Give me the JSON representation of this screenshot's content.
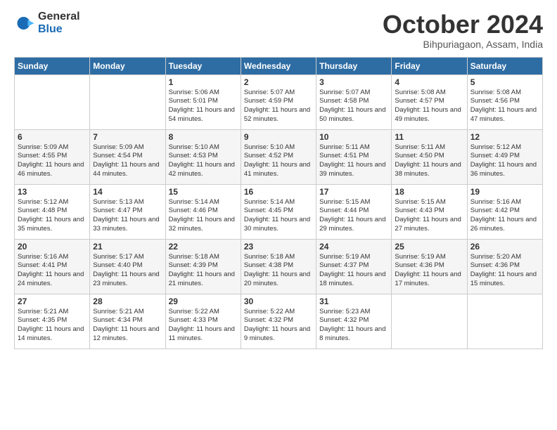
{
  "logo": {
    "general": "General",
    "blue": "Blue"
  },
  "title": "October 2024",
  "location": "Bihpuriagaon, Assam, India",
  "days_header": [
    "Sunday",
    "Monday",
    "Tuesday",
    "Wednesday",
    "Thursday",
    "Friday",
    "Saturday"
  ],
  "weeks": [
    [
      {
        "day": "",
        "info": ""
      },
      {
        "day": "",
        "info": ""
      },
      {
        "day": "1",
        "info": "Sunrise: 5:06 AM\nSunset: 5:01 PM\nDaylight: 11 hours\nand 54 minutes."
      },
      {
        "day": "2",
        "info": "Sunrise: 5:07 AM\nSunset: 4:59 PM\nDaylight: 11 hours\nand 52 minutes."
      },
      {
        "day": "3",
        "info": "Sunrise: 5:07 AM\nSunset: 4:58 PM\nDaylight: 11 hours\nand 50 minutes."
      },
      {
        "day": "4",
        "info": "Sunrise: 5:08 AM\nSunset: 4:57 PM\nDaylight: 11 hours\nand 49 minutes."
      },
      {
        "day": "5",
        "info": "Sunrise: 5:08 AM\nSunset: 4:56 PM\nDaylight: 11 hours\nand 47 minutes."
      }
    ],
    [
      {
        "day": "6",
        "info": "Sunrise: 5:09 AM\nSunset: 4:55 PM\nDaylight: 11 hours\nand 46 minutes."
      },
      {
        "day": "7",
        "info": "Sunrise: 5:09 AM\nSunset: 4:54 PM\nDaylight: 11 hours\nand 44 minutes."
      },
      {
        "day": "8",
        "info": "Sunrise: 5:10 AM\nSunset: 4:53 PM\nDaylight: 11 hours\nand 42 minutes."
      },
      {
        "day": "9",
        "info": "Sunrise: 5:10 AM\nSunset: 4:52 PM\nDaylight: 11 hours\nand 41 minutes."
      },
      {
        "day": "10",
        "info": "Sunrise: 5:11 AM\nSunset: 4:51 PM\nDaylight: 11 hours\nand 39 minutes."
      },
      {
        "day": "11",
        "info": "Sunrise: 5:11 AM\nSunset: 4:50 PM\nDaylight: 11 hours\nand 38 minutes."
      },
      {
        "day": "12",
        "info": "Sunrise: 5:12 AM\nSunset: 4:49 PM\nDaylight: 11 hours\nand 36 minutes."
      }
    ],
    [
      {
        "day": "13",
        "info": "Sunrise: 5:12 AM\nSunset: 4:48 PM\nDaylight: 11 hours\nand 35 minutes."
      },
      {
        "day": "14",
        "info": "Sunrise: 5:13 AM\nSunset: 4:47 PM\nDaylight: 11 hours\nand 33 minutes."
      },
      {
        "day": "15",
        "info": "Sunrise: 5:14 AM\nSunset: 4:46 PM\nDaylight: 11 hours\nand 32 minutes."
      },
      {
        "day": "16",
        "info": "Sunrise: 5:14 AM\nSunset: 4:45 PM\nDaylight: 11 hours\nand 30 minutes."
      },
      {
        "day": "17",
        "info": "Sunrise: 5:15 AM\nSunset: 4:44 PM\nDaylight: 11 hours\nand 29 minutes."
      },
      {
        "day": "18",
        "info": "Sunrise: 5:15 AM\nSunset: 4:43 PM\nDaylight: 11 hours\nand 27 minutes."
      },
      {
        "day": "19",
        "info": "Sunrise: 5:16 AM\nSunset: 4:42 PM\nDaylight: 11 hours\nand 26 minutes."
      }
    ],
    [
      {
        "day": "20",
        "info": "Sunrise: 5:16 AM\nSunset: 4:41 PM\nDaylight: 11 hours\nand 24 minutes."
      },
      {
        "day": "21",
        "info": "Sunrise: 5:17 AM\nSunset: 4:40 PM\nDaylight: 11 hours\nand 23 minutes."
      },
      {
        "day": "22",
        "info": "Sunrise: 5:18 AM\nSunset: 4:39 PM\nDaylight: 11 hours\nand 21 minutes."
      },
      {
        "day": "23",
        "info": "Sunrise: 5:18 AM\nSunset: 4:38 PM\nDaylight: 11 hours\nand 20 minutes."
      },
      {
        "day": "24",
        "info": "Sunrise: 5:19 AM\nSunset: 4:37 PM\nDaylight: 11 hours\nand 18 minutes."
      },
      {
        "day": "25",
        "info": "Sunrise: 5:19 AM\nSunset: 4:36 PM\nDaylight: 11 hours\nand 17 minutes."
      },
      {
        "day": "26",
        "info": "Sunrise: 5:20 AM\nSunset: 4:36 PM\nDaylight: 11 hours\nand 15 minutes."
      }
    ],
    [
      {
        "day": "27",
        "info": "Sunrise: 5:21 AM\nSunset: 4:35 PM\nDaylight: 11 hours\nand 14 minutes."
      },
      {
        "day": "28",
        "info": "Sunrise: 5:21 AM\nSunset: 4:34 PM\nDaylight: 11 hours\nand 12 minutes."
      },
      {
        "day": "29",
        "info": "Sunrise: 5:22 AM\nSunset: 4:33 PM\nDaylight: 11 hours\nand 11 minutes."
      },
      {
        "day": "30",
        "info": "Sunrise: 5:22 AM\nSunset: 4:32 PM\nDaylight: 11 hours\nand 9 minutes."
      },
      {
        "day": "31",
        "info": "Sunrise: 5:23 AM\nSunset: 4:32 PM\nDaylight: 11 hours\nand 8 minutes."
      },
      {
        "day": "",
        "info": ""
      },
      {
        "day": "",
        "info": ""
      }
    ]
  ]
}
